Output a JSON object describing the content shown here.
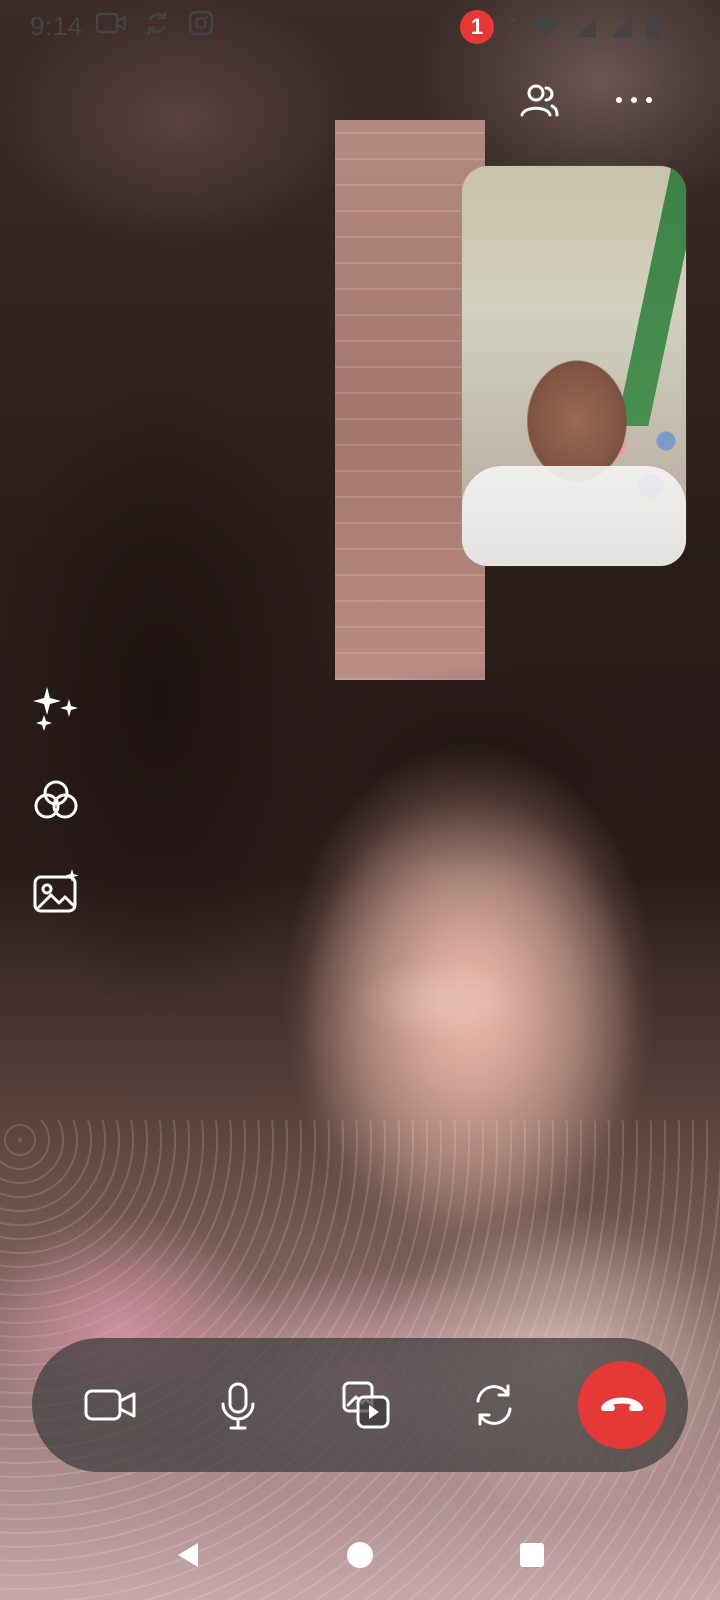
{
  "status_bar": {
    "time": "9:14",
    "notification_count": "1",
    "left_icons": [
      "video-camera-icon",
      "sync-icon",
      "instagram-icon"
    ],
    "right_icons": [
      "data-arrows-icon",
      "wifi-icon",
      "signal-icon",
      "signal-icon",
      "battery-icon"
    ]
  },
  "top_actions": {
    "participants_icon": "people-icon",
    "more_icon": "more-horizontal-icon"
  },
  "left_tools": {
    "items": [
      "sparkles-effects-icon",
      "filters-icon",
      "background-image-icon"
    ]
  },
  "call_controls": {
    "items": [
      "camera-icon",
      "microphone-icon",
      "share-media-icon",
      "flip-camera-icon",
      "end-call-icon"
    ],
    "end_call_color": "#e53935"
  },
  "navigation": {
    "items": [
      "back-icon",
      "home-icon",
      "recents-icon"
    ]
  }
}
